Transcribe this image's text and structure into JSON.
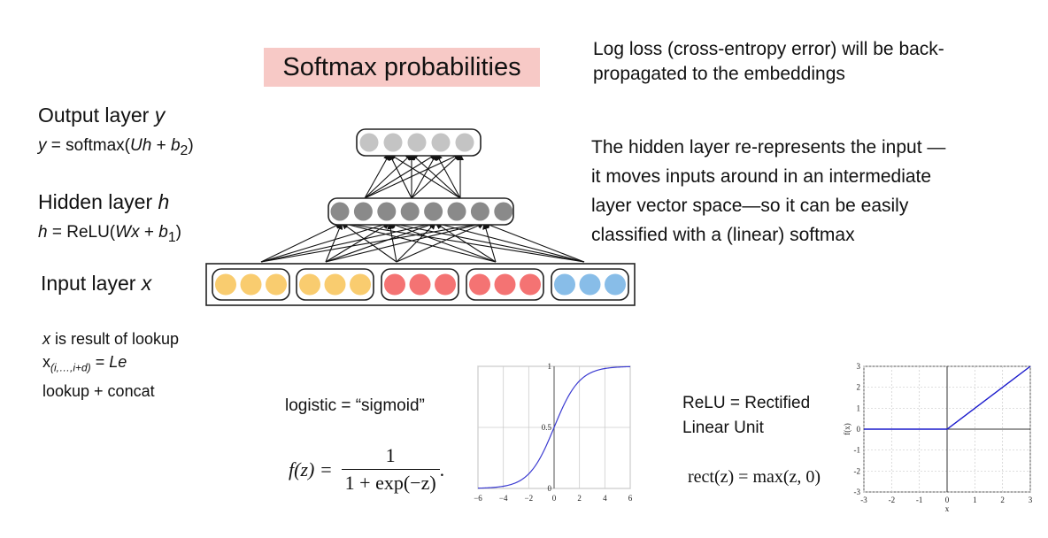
{
  "title": "Softmax probabilities",
  "top_right_note": [
    "Log loss (cross-entropy error) will be back-",
    "propagated to the embeddings"
  ],
  "hidden_note": [
    "The hidden layer re-represents the input —",
    "it moves inputs around in an intermediate",
    "layer vector space—so it can be easily",
    "classified with a (linear) softmax"
  ],
  "output_layer": {
    "label": "Output layer",
    "var": "y",
    "formula_lhs": "y",
    "formula_mid": " = softmax(",
    "formula_var": "Uh",
    "formula_plus": " + ",
    "formula_b": "b",
    "formula_sub": "2",
    "formula_end": ")"
  },
  "hidden_layer": {
    "label": "Hidden layer",
    "var": "h",
    "formula_lhs": "h",
    "formula_mid": " = ReLU(",
    "formula_var": "Wx",
    "formula_plus": " + ",
    "formula_b": "b",
    "formula_sub": "1",
    "formula_end": ")"
  },
  "input_layer": {
    "label": "Input layer",
    "var": "x"
  },
  "lookup_note": {
    "line1_var": "x",
    "line1_rest": " is result of lookup",
    "line2_var": "x",
    "line2_sub": "(i,…,i+d)",
    "line2_eq": " = ",
    "line2_rhs": "Le",
    "line3": "lookup + concat"
  },
  "network": {
    "output_nodes": 5,
    "hidden_nodes": 8,
    "input_groups": 5,
    "nodes_per_group": 3,
    "colors": {
      "output": "#c4c4c4",
      "hidden": "#8a8a8a",
      "orange": "#f9cc6f",
      "red": "#f47373",
      "blue": "#88bde8"
    },
    "input_group_colors": [
      "orange",
      "orange",
      "red",
      "red",
      "blue"
    ]
  },
  "sigmoid": {
    "label": "logistic = “sigmoid”",
    "formula_lhs": "f(z) =",
    "numerator": "1",
    "denominator": "1 + exp(−z)",
    "trailing": ".",
    "chart_data": {
      "type": "line",
      "function": "1/(1+exp(-x))",
      "xlim": [
        -6,
        6
      ],
      "ylim": [
        0,
        1
      ],
      "xticks": [
        "−6",
        "−4",
        "−2",
        "0",
        "2",
        "4",
        "6"
      ],
      "yticks": [
        "0",
        "0.5",
        "1"
      ],
      "grid": true,
      "color": "#3b3bd1",
      "x": [
        -6,
        -4,
        -2,
        0,
        2,
        4,
        6
      ],
      "y": [
        0.0025,
        0.018,
        0.119,
        0.5,
        0.881,
        0.982,
        0.9975
      ]
    }
  },
  "relu": {
    "label": [
      "ReLU = Rectified",
      "Linear Unit"
    ],
    "formula": "rect(z) = max(z, 0)",
    "chart_data": {
      "type": "line",
      "function": "max(x,0)",
      "xlim": [
        -3,
        3
      ],
      "ylim": [
        -3,
        3
      ],
      "xticks": [
        "-3",
        "-2",
        "-1",
        "0",
        "1",
        "2",
        "3"
      ],
      "yticks": [
        "-3",
        "-2",
        "-1",
        "0",
        "1",
        "2",
        "3"
      ],
      "xlabel": "x",
      "ylabel": "f(x)",
      "grid": true,
      "color": "#1a1acc",
      "x": [
        -3,
        0,
        3
      ],
      "y": [
        0,
        0,
        3
      ]
    }
  }
}
